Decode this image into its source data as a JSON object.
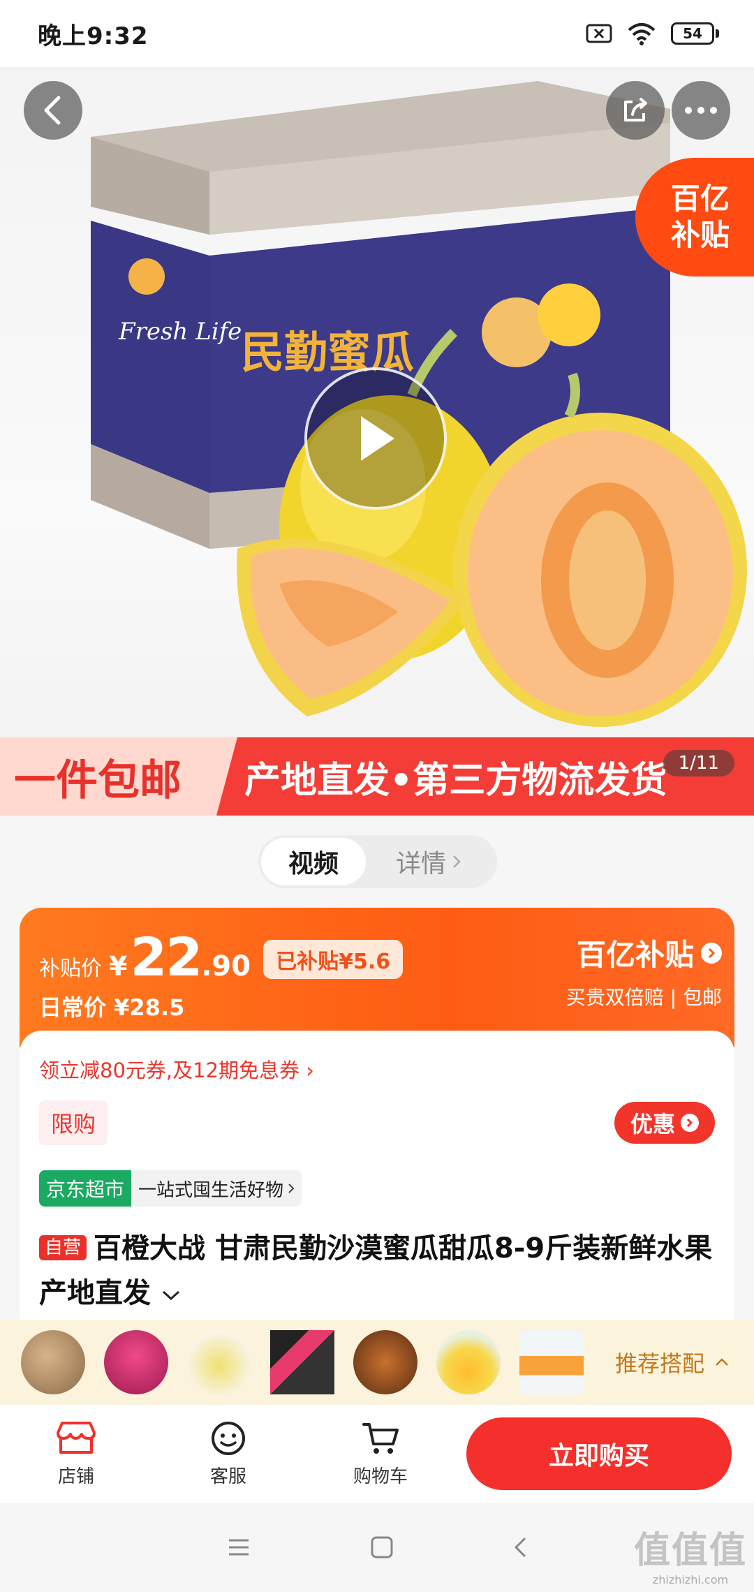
{
  "status_bar": {
    "time": "晚上9:32",
    "battery": "54"
  },
  "hero": {
    "subsidy_badge_line1": "百亿",
    "subsidy_badge_line2": "补贴",
    "box_brand": "民勤蜜瓜",
    "box_script": "Fresh Life",
    "banner_left": "一件包邮",
    "banner_right": "产地直发•第三方物流发货",
    "page_counter": "1/11"
  },
  "media_tabs": {
    "video": "视频",
    "detail": "详情"
  },
  "price_card": {
    "label": "补贴价",
    "yen": "¥",
    "price_int": "22",
    "price_dec": ".90",
    "subsidized": "已补贴¥5.6",
    "daily_price": "日常价 ¥28.5",
    "brand": "百亿补贴",
    "brand_sub": "买贵双倍赔 | 包邮"
  },
  "info": {
    "coupon": "领立减80元券,及12期免息券 ›",
    "limit_tag": "限购",
    "discount_button": "优惠",
    "store_tag": "京东超市",
    "store_slogan": "一站式囤生活好物",
    "self_tag": "自营",
    "title": "百橙大战 甘肃民勤沙漠蜜瓜甜瓜8-9斤装新鲜水果 产地直发"
  },
  "recommend": {
    "label": "推荐搭配"
  },
  "action_bar": {
    "shop": "店铺",
    "service": "客服",
    "cart": "购物车",
    "buy": "立即购买"
  },
  "watermark": {
    "glyph": "值值值",
    "url": "zhizhizhi.com"
  },
  "colors": {
    "accent": "#f52f2b",
    "orange": "#ff5b14",
    "jd_green": "#1aaa62"
  }
}
